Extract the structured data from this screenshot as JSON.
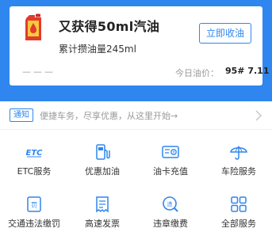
{
  "card": {
    "title": "又获得50ml汽油",
    "subtitle": "累计攒油量245ml",
    "claim_button": "立即收油",
    "placeholder": "———",
    "price_label": "今日油价：",
    "price_value": "95# 7.11"
  },
  "notice": {
    "tag": "通知",
    "text": "便捷车务，尽享优惠，从这里开始→"
  },
  "services": [
    {
      "label": "ETC服务",
      "icon": "etc-icon"
    },
    {
      "label": "优惠加油",
      "icon": "fuel-pump-icon"
    },
    {
      "label": "油卡充值",
      "icon": "fuel-card-icon"
    },
    {
      "label": "车险服务",
      "icon": "umbrella-icon"
    },
    {
      "label": "交通违法缴罚",
      "icon": "fine-icon"
    },
    {
      "label": "高速发票",
      "icon": "invoice-icon"
    },
    {
      "label": "违章缴费",
      "icon": "violation-search-icon"
    },
    {
      "label": "全部服务",
      "icon": "grid-icon"
    }
  ],
  "colors": {
    "accent": "#2f86ee",
    "can_red": "#e23a2e",
    "can_yellow": "#f7c93d"
  }
}
